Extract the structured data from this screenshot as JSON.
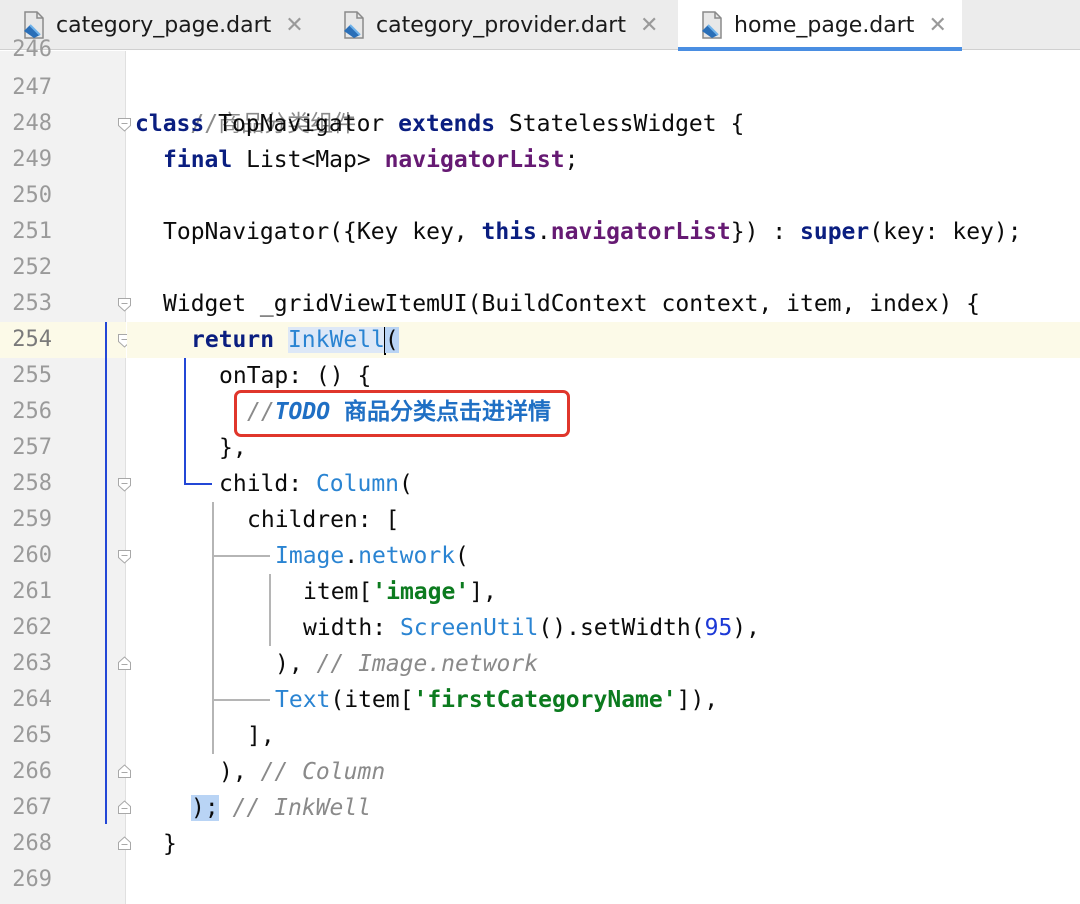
{
  "tabs": [
    {
      "label": "category_page.dart",
      "active": false
    },
    {
      "label": "category_provider.dart",
      "active": false
    },
    {
      "label": "home_page.dart",
      "active": true
    }
  ],
  "close_glyph": "✕",
  "line_numbers": [
    "246",
    "247",
    "248",
    "249",
    "250",
    "251",
    "252",
    "253",
    "254",
    "255",
    "256",
    "257",
    "258",
    "259",
    "260",
    "261",
    "262",
    "263",
    "264",
    "265",
    "266",
    "267",
    "268",
    "269"
  ],
  "current_line": "254",
  "code": {
    "l247": {
      "comment": "//商品分类组件"
    },
    "l248": {
      "kw1": "class",
      "t1": " TopNavigator ",
      "kw2": "extends",
      "t2": " StatelessWidget {"
    },
    "l249": {
      "kw": "final",
      "t1": " List<Map> ",
      "field": "navigatorList",
      "t2": ";"
    },
    "l251": {
      "t1": "TopNavigator({Key key, ",
      "kw1": "this",
      "t2": ".",
      "field": "navigatorList",
      "t3": "}) : ",
      "kw2": "super",
      "t4": "(key: key);"
    },
    "l253": {
      "t1": "Widget _gridViewItemUI(BuildContext context, item, index) {"
    },
    "l254": {
      "kw": "return",
      "sp": " ",
      "cls": "InkWell",
      "t1": "("
    },
    "l255": {
      "t1": "onTap: () {"
    },
    "l256": {
      "c1": "//",
      "todo": "TODO",
      "zh": " 商品分类点击进详情"
    },
    "l257": {
      "t1": "},"
    },
    "l258": {
      "t1": "child: ",
      "cls": "Column",
      "t2": "("
    },
    "l259": {
      "t1": "children: ["
    },
    "l260": {
      "cls1": "Image",
      "t1": ".",
      "cls2": "network",
      "t2": "("
    },
    "l261": {
      "t1": "item[",
      "str": "'image'",
      "t2": "],"
    },
    "l262": {
      "t1": "width: ",
      "cls": "ScreenUtil",
      "t2": "().setWidth(",
      "num": "95",
      "t3": "),"
    },
    "l263": {
      "t1": "), ",
      "cmt": "// Image.network"
    },
    "l264": {
      "cls": "Text",
      "t1": "(item[",
      "str": "'firstCategoryName'",
      "t2": "]),"
    },
    "l265": {
      "t1": "],"
    },
    "l266": {
      "t1": "), ",
      "cmt": "// Column"
    },
    "l267": {
      "t1": ");",
      "cmt": " // InkWell"
    },
    "l268": {
      "t1": "}"
    }
  },
  "colors": {
    "keyword": "#0a1e80",
    "field": "#661a73",
    "class": "#2a84d2",
    "string": "#0c7b1f",
    "number": "#1d39d6",
    "comment": "#8a8a8a",
    "todo": "#1f6fc4",
    "highlight_box": "#e0362b",
    "active_tab_underline": "#4a8ee2"
  }
}
